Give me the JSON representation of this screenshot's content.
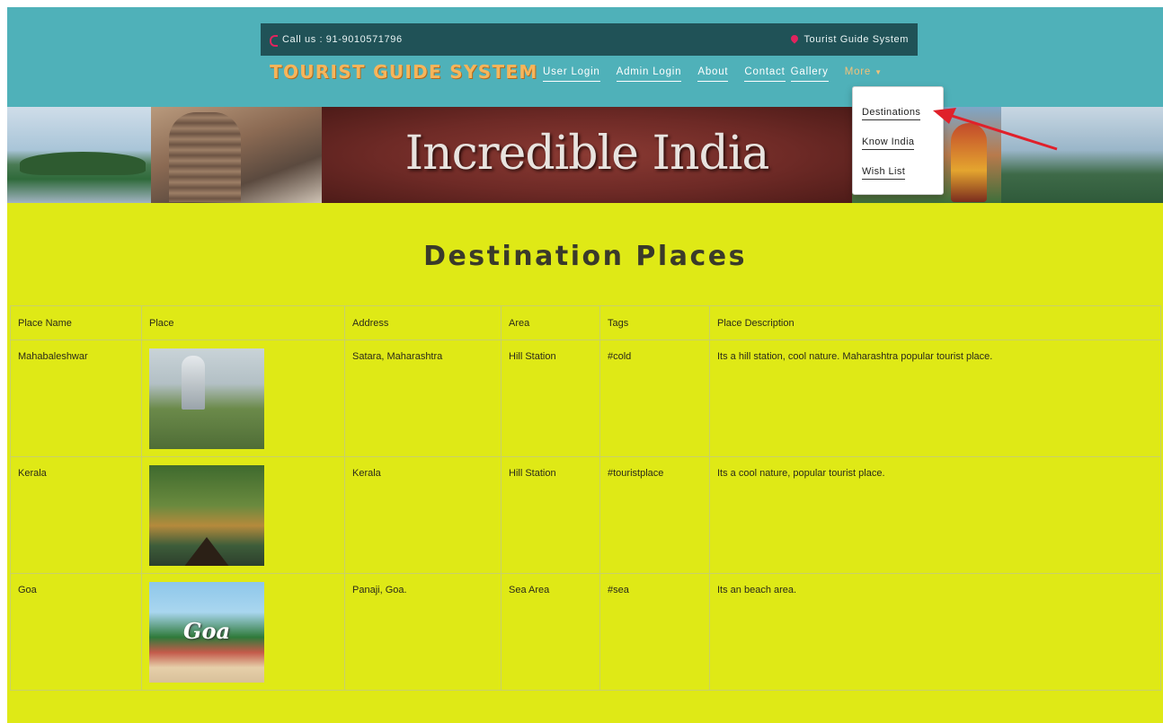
{
  "topbar": {
    "call_label": "Call us : 91-9010571796",
    "site_label": "Tourist Guide System"
  },
  "brand": "TOURIST GUIDE SYSTEM",
  "nav": {
    "user_login": "User Login",
    "admin_login": "Admin Login",
    "about": "About",
    "contact": "Contact",
    "gallery": "Gallery",
    "more": "More"
  },
  "banner": {
    "title": "Incredible India"
  },
  "dropdown": {
    "destinations": "Destinations",
    "know_india": "Know India",
    "wish_list": "Wish List"
  },
  "page_heading": "Destination Places",
  "table": {
    "headers": [
      "Place Name",
      "Place",
      "Address",
      "Area",
      "Tags",
      "Place Description"
    ],
    "rows": [
      {
        "name": "Mahabaleshwar",
        "image_text": "",
        "address": "Satara, Maharashtra",
        "area": "Hill Station",
        "tags": "#cold",
        "description": "Its a hill station, cool nature. Maharashtra popular tourist place."
      },
      {
        "name": "Kerala",
        "image_text": "",
        "address": "Kerala",
        "area": "Hill Station",
        "tags": "#touristplace",
        "description": "Its a cool nature, popular tourist place."
      },
      {
        "name": "Goa",
        "image_text": "Goa",
        "address": "Panaji, Goa.",
        "area": "Sea Area",
        "tags": "#sea",
        "description": "Its an beach area."
      }
    ]
  },
  "colors": {
    "header_bg": "#4fb1b9",
    "topbar_bg": "#205257",
    "brand": "#f6b55b",
    "content_bg": "#dfe916",
    "arrow": "#e0202a"
  }
}
